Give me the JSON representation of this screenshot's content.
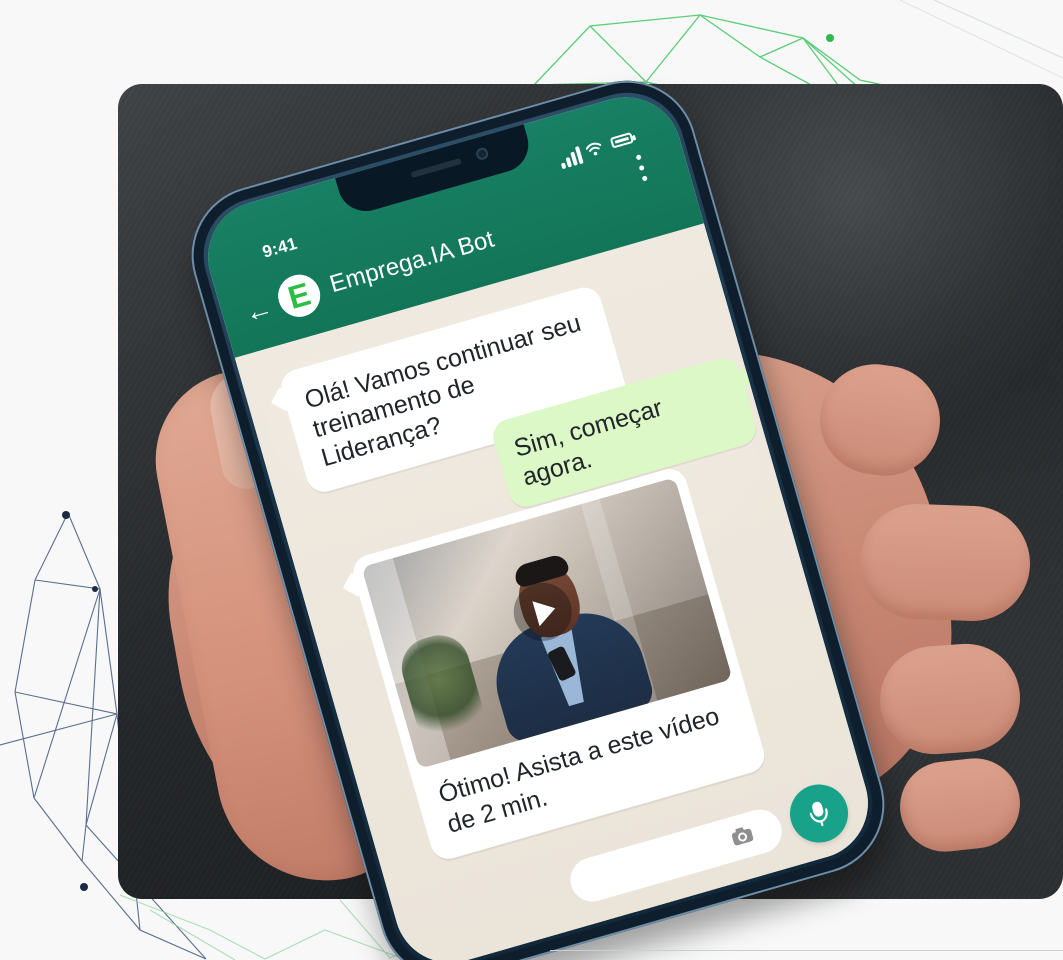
{
  "chat": {
    "status_time": "9:41",
    "bot_name": "Emprega.IA Bot",
    "avatar_letter": "E",
    "messages": [
      {
        "type": "incoming",
        "text": "Olá! Vamos continuar seu treinamento de Liderança?"
      },
      {
        "type": "outgoing",
        "text": "Sim, começar agora."
      },
      {
        "type": "incoming-video",
        "caption": "Ótimo! Asista a este vídeo de 2 min."
      }
    ]
  },
  "icons": {
    "back": "arrow-left-icon",
    "menu": "vertical-dots-icon",
    "signal": "signal-icon",
    "wifi": "wifi-icon",
    "battery": "battery-icon",
    "play": "play-icon",
    "camera": "camera-icon",
    "mic": "microphone-icon"
  },
  "colors": {
    "header": "#188064",
    "incoming_bubble": "#ffffff",
    "outgoing_bubble": "#dcf8c6",
    "mic_button": "#18a28a",
    "avatar_brand": "#2dbd45"
  }
}
